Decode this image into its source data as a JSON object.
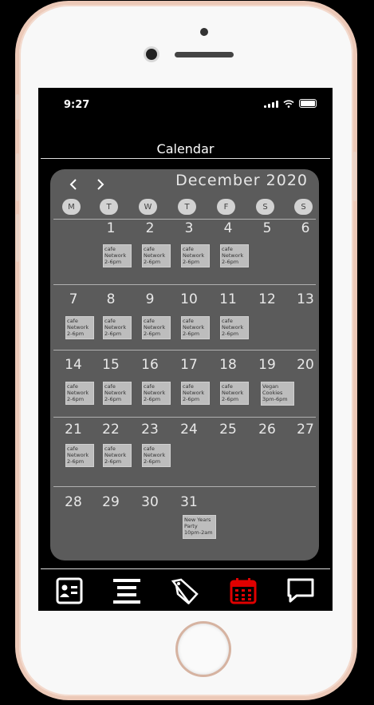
{
  "status": {
    "time": "9:27"
  },
  "header": {
    "title": "Calendar"
  },
  "calendar": {
    "month_label": "December 2020",
    "prev_label": "‹",
    "next_label": "›",
    "weekdays": [
      "M",
      "T",
      "W",
      "T",
      "F",
      "S",
      "S"
    ],
    "weeks": [
      {
        "days": [
          "",
          "1",
          "2",
          "3",
          "4",
          "5",
          "6"
        ]
      },
      {
        "days": [
          "7",
          "8",
          "9",
          "10",
          "11",
          "12",
          "13"
        ]
      },
      {
        "days": [
          "14",
          "15",
          "16",
          "17",
          "18",
          "19",
          "20"
        ]
      },
      {
        "days": [
          "21",
          "22",
          "23",
          "24",
          "25",
          "26",
          "27"
        ]
      },
      {
        "days": [
          "28",
          "29",
          "30",
          "31",
          "",
          "",
          ""
        ]
      }
    ],
    "events": [
      {
        "week": 0,
        "day": 1,
        "lines": [
          "cafe",
          "Network",
          "2-6pm"
        ]
      },
      {
        "week": 0,
        "day": 2,
        "lines": [
          "cafe",
          "Network",
          "2-6pm"
        ]
      },
      {
        "week": 0,
        "day": 3,
        "lines": [
          "cafe",
          "Network",
          "2-6pm"
        ]
      },
      {
        "week": 0,
        "day": 4,
        "lines": [
          "cafe",
          "Network",
          "2-6pm"
        ]
      },
      {
        "week": 1,
        "day": 0,
        "lines": [
          "cafe",
          "Network",
          "2-6pm"
        ]
      },
      {
        "week": 1,
        "day": 1,
        "lines": [
          "cafe",
          "Network",
          "2-6pm"
        ]
      },
      {
        "week": 1,
        "day": 2,
        "lines": [
          "cafe",
          "Network",
          "2-6pm"
        ]
      },
      {
        "week": 1,
        "day": 3,
        "lines": [
          "cafe",
          "Network",
          "2-6pm"
        ]
      },
      {
        "week": 1,
        "day": 4,
        "lines": [
          "cafe",
          "Network",
          "2-6pm"
        ]
      },
      {
        "week": 2,
        "day": 0,
        "lines": [
          "cafe",
          "Network",
          "2-6pm"
        ]
      },
      {
        "week": 2,
        "day": 1,
        "lines": [
          "cafe",
          "Network",
          "2-6pm"
        ]
      },
      {
        "week": 2,
        "day": 2,
        "lines": [
          "cafe",
          "Network",
          "2-6pm"
        ]
      },
      {
        "week": 2,
        "day": 3,
        "lines": [
          "cafe",
          "Network",
          "2-6pm"
        ]
      },
      {
        "week": 2,
        "day": 4,
        "lines": [
          "cafe",
          "Network",
          "2-6pm"
        ]
      },
      {
        "week": 2,
        "day": 5,
        "lines": [
          "Vegan",
          "Cookies",
          "3pm-6pm"
        ]
      },
      {
        "week": 3,
        "day": 0,
        "lines": [
          "cafe",
          "Network",
          "2-6pm"
        ]
      },
      {
        "week": 3,
        "day": 1,
        "lines": [
          "cafe",
          "Network",
          "2-6pm"
        ]
      },
      {
        "week": 3,
        "day": 2,
        "lines": [
          "cafe",
          "Network",
          "2-6pm"
        ]
      },
      {
        "week": 4,
        "day": 3,
        "lines": [
          "New Years",
          "Party",
          "10pm-2am"
        ]
      }
    ]
  },
  "tabbar": {
    "items": [
      {
        "icon": "contact-card-icon"
      },
      {
        "icon": "menu-lines-icon"
      },
      {
        "icon": "tags-icon"
      },
      {
        "icon": "calendar-icon",
        "active": true
      },
      {
        "icon": "chat-icon"
      }
    ],
    "active_color": "#e00000"
  }
}
